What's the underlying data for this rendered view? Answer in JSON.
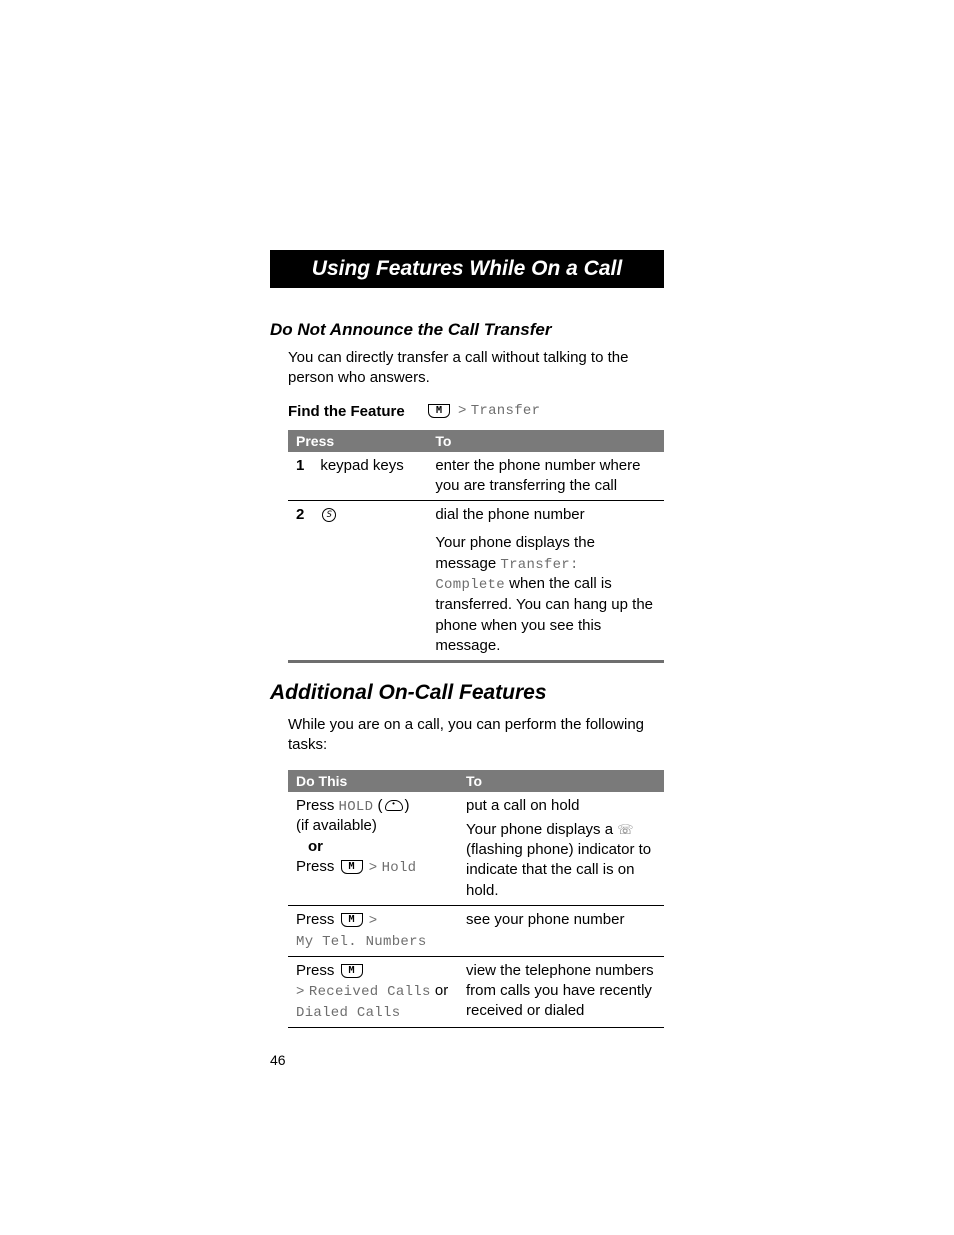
{
  "title_bar": "Using Features While On a Call",
  "subhead1": "Do Not Announce the Call Transfer",
  "intro1": "You can directly transfer a call without talking to the person who answers.",
  "find_feature_label": "Find the Feature",
  "feature_transfer": "Transfer",
  "gt": ">",
  "table1": {
    "h_press": "Press",
    "h_to": "To",
    "r1_step": "1",
    "r1_press": "keypad keys",
    "r1_to": "enter the phone number where you are transferring the call",
    "r2_step": "2",
    "r2_to_a": "dial the phone number",
    "r2_to_b_pre": "Your phone displays the message ",
    "r2_to_b_mono": "Transfer: Complete",
    "r2_to_b_post": " when the call is transferred. You can hang up the phone when you see this message."
  },
  "section2": "Additional On-Call Features",
  "intro2": "While you are on a call, you can perform the following tasks:",
  "table2": {
    "h_do": "Do This",
    "h_to": "To",
    "r1_press": "Press ",
    "r1_hold": "HOLD",
    "r1_avail": "(if available)",
    "r1_or": "or",
    "r1_press2": "Press ",
    "r1_hold2": "Hold",
    "r1_to_a": "put a call on hold",
    "r1_to_b_pre": "Your phone displays a ",
    "r1_to_b_post": " (flashing phone) indicator to indicate that the call is on hold.",
    "r2_press": "Press ",
    "r2_mono": "My Tel. Numbers",
    "r2_to": "see your phone number",
    "r3_press": "Press ",
    "r3_recv": "Received Calls",
    "r3_or": " or ",
    "r3_dial": "Dialed Calls",
    "r3_to": "view the telephone numbers from calls you have recently received or dialed"
  },
  "page_num": "46"
}
